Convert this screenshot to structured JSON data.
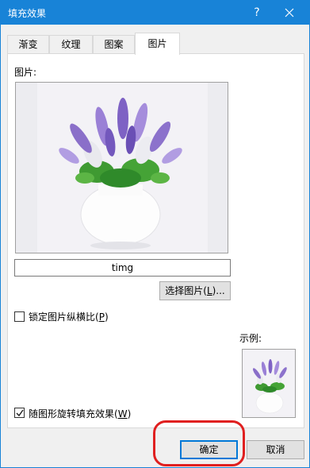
{
  "window": {
    "title": "填充效果",
    "help_label": "?",
    "close_icon": "close-icon"
  },
  "tabs": [
    {
      "label": "渐变",
      "active": false
    },
    {
      "label": "纹理",
      "active": false
    },
    {
      "label": "图案",
      "active": false
    },
    {
      "label": "图片",
      "active": true
    }
  ],
  "picture_section": {
    "label": "图片:",
    "file_name": "timg",
    "select_button_prefix": "选择图片(",
    "select_button_hotkey": "L",
    "select_button_suffix": ")..."
  },
  "lock_aspect": {
    "prefix": "锁定图片纵横比(",
    "hotkey": "P",
    "suffix": ")",
    "checked": false
  },
  "rotate_with_shape": {
    "prefix": "随图形旋转填充效果(",
    "hotkey": "W",
    "suffix": ")",
    "checked": true
  },
  "sample": {
    "label": "示例:"
  },
  "buttons": {
    "ok": "确定",
    "cancel": "取消"
  },
  "colors": {
    "titlebar": "#1883d7",
    "highlight": "#e02020",
    "default_button_border": "#0078d7"
  }
}
